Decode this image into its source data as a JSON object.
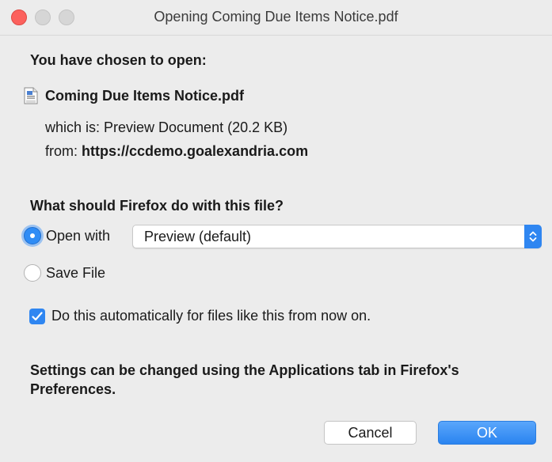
{
  "window": {
    "title": "Opening Coming Due Items Notice.pdf"
  },
  "dialog": {
    "heading": "You have chosen to open:",
    "file_name": "Coming Due Items Notice.pdf",
    "file_icon": "pdf-file-icon",
    "which_is": "which is: Preview Document (20.2 KB)",
    "from_label": "from: ",
    "from_host": "https://ccdemo.goalexandria.com",
    "question": "What should Firefox do with this file?",
    "open_with_label": "Open with",
    "open_with_app": "Preview (default)",
    "save_file_label": "Save File",
    "selected_option": "open_with",
    "auto_label": "Do this automatically for files like this from now on.",
    "auto_checked": true,
    "note": "Settings can be changed using the Applications tab in Firefox's Preferences."
  },
  "buttons": {
    "cancel": "Cancel",
    "ok": "OK"
  },
  "colors": {
    "accent": "#2f86f1",
    "close": "#fc615d"
  }
}
